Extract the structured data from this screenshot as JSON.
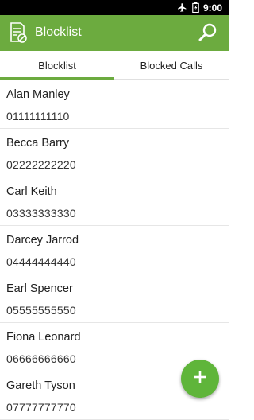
{
  "status_bar": {
    "time": "9:00",
    "icons": [
      "airplane-icon",
      "battery-icon"
    ]
  },
  "app_bar": {
    "title": "Blocklist",
    "icons": [
      "blocklist-app-icon",
      "search-icon"
    ]
  },
  "tabs": [
    {
      "label": "Blocklist",
      "selected": true
    },
    {
      "label": "Blocked Calls",
      "selected": false
    }
  ],
  "contacts": [
    {
      "name": "Alan Manley",
      "number": "01111111110"
    },
    {
      "name": "Becca Barry",
      "number": "02222222220"
    },
    {
      "name": "Carl Keith",
      "number": "03333333330"
    },
    {
      "name": "Darcey Jarrod",
      "number": "04444444440"
    },
    {
      "name": "Earl Spencer",
      "number": "05555555550"
    },
    {
      "name": "Fiona Leonard",
      "number": "06666666660"
    },
    {
      "name": "Gareth Tyson",
      "number": "07777777770"
    }
  ],
  "fab": {
    "icon": "add-icon"
  },
  "colors": {
    "accent": "#6cab3f",
    "fab": "#5fb53a",
    "status_bar": "#000000"
  }
}
